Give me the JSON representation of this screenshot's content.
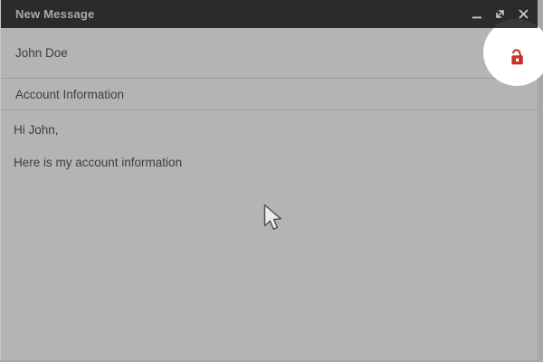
{
  "window": {
    "title": "New Message",
    "controls": [
      {
        "icon": "minimize-icon"
      },
      {
        "icon": "expand-icon"
      },
      {
        "icon": "close-icon"
      }
    ]
  },
  "compose": {
    "recipient": "John Doe",
    "subject": "Account Information",
    "body": {
      "line1": "Hi John,",
      "line2": "Here is my account information"
    }
  },
  "annotations": {
    "highlight": "spotlight-circle-around-security-icon",
    "security_icon": "unlocked-padlock-icon",
    "pointer": "arrow-cursor"
  },
  "colors": {
    "titlebar_bg": "#2b2b2b",
    "title_text": "#a9a9a9",
    "window_bg": "#b4b4b4",
    "outside_bg": "#a7a7a7",
    "divider": "#9c9c9c",
    "body_text": "#3e3e3e",
    "lock_red": "#cc2e20",
    "highlight_circle": "#ffffff"
  }
}
